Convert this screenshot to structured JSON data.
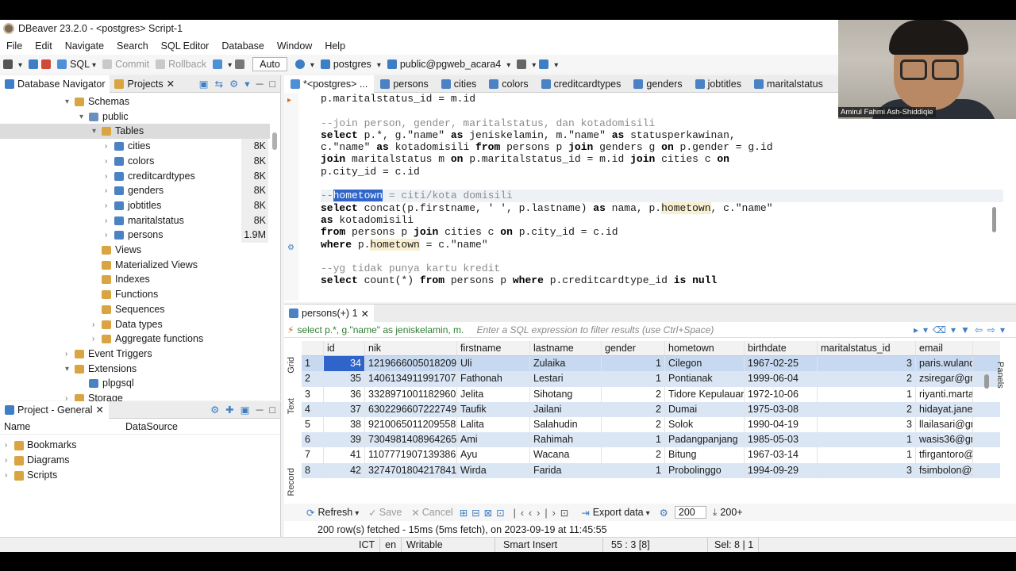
{
  "window": {
    "title": "DBeaver 23.2.0 - <postgres> Script-1"
  },
  "menu": [
    "File",
    "Edit",
    "Navigate",
    "Search",
    "SQL Editor",
    "Database",
    "Window",
    "Help"
  ],
  "toolbar": {
    "sql": "SQL",
    "commit": "Commit",
    "rollback": "Rollback",
    "auto": "Auto",
    "connection": "postgres",
    "schema": "public@pgweb_acara4"
  },
  "webcam": {
    "name": "Amirul Fahmi Ash-Shiddiqie"
  },
  "navigator": {
    "tabs": [
      "Database Navigator",
      "Projects"
    ],
    "tree": [
      {
        "label": "Schemas",
        "level": 0,
        "twist": "▾",
        "icon": "folder-icon",
        "color": "#d9a441"
      },
      {
        "label": "public",
        "level": 1,
        "twist": "▾",
        "icon": "schema-icon",
        "color": "#6b8fbf"
      },
      {
        "label": "Tables",
        "level": 2,
        "twist": "▾",
        "icon": "folder-icon",
        "color": "#d9a441",
        "selected": true
      },
      {
        "label": "cities",
        "level": 3,
        "twist": "›",
        "icon": "table-icon",
        "color": "#4a82c3",
        "size": "8K"
      },
      {
        "label": "colors",
        "level": 3,
        "twist": "›",
        "icon": "table-icon",
        "color": "#4a82c3",
        "size": "8K"
      },
      {
        "label": "creditcardtypes",
        "level": 3,
        "twist": "›",
        "icon": "table-icon",
        "color": "#4a82c3",
        "size": "8K"
      },
      {
        "label": "genders",
        "level": 3,
        "twist": "›",
        "icon": "table-icon",
        "color": "#4a82c3",
        "size": "8K"
      },
      {
        "label": "jobtitles",
        "level": 3,
        "twist": "›",
        "icon": "table-icon",
        "color": "#4a82c3",
        "size": "8K"
      },
      {
        "label": "maritalstatus",
        "level": 3,
        "twist": "›",
        "icon": "table-icon",
        "color": "#4a82c3",
        "size": "8K"
      },
      {
        "label": "persons",
        "level": 3,
        "twist": "›",
        "icon": "table-icon",
        "color": "#4a82c3",
        "size": "1.9M"
      },
      {
        "label": "Views",
        "level": 2,
        "twist": "",
        "icon": "folder-icon",
        "color": "#d9a441"
      },
      {
        "label": "Materialized Views",
        "level": 2,
        "twist": "",
        "icon": "folder-icon",
        "color": "#d9a441"
      },
      {
        "label": "Indexes",
        "level": 2,
        "twist": "",
        "icon": "folder-icon",
        "color": "#d9a441"
      },
      {
        "label": "Functions",
        "level": 2,
        "twist": "",
        "icon": "folder-icon",
        "color": "#d9a441"
      },
      {
        "label": "Sequences",
        "level": 2,
        "twist": "",
        "icon": "folder-icon",
        "color": "#d9a441"
      },
      {
        "label": "Data types",
        "level": 2,
        "twist": "›",
        "icon": "folder-icon",
        "color": "#d9a441"
      },
      {
        "label": "Aggregate functions",
        "level": 2,
        "twist": "›",
        "icon": "folder-icon",
        "color": "#d9a441"
      },
      {
        "label": "Event Triggers",
        "level": 0,
        "twist": "›",
        "icon": "folder-icon",
        "color": "#d9a441"
      },
      {
        "label": "Extensions",
        "level": 0,
        "twist": "▾",
        "icon": "folder-icon",
        "color": "#d9a441"
      },
      {
        "label": "plpgsql",
        "level": 1,
        "twist": "",
        "icon": "extension-icon",
        "color": "#4a82c3"
      },
      {
        "label": "Storage",
        "level": 0,
        "twist": "›",
        "icon": "folder-icon",
        "color": "#d9a441"
      }
    ]
  },
  "project": {
    "tab": "Project - General",
    "columns": [
      "Name",
      "DataSource"
    ],
    "items": [
      "Bookmarks",
      "Diagrams",
      "Scripts"
    ]
  },
  "editor": {
    "tabs": [
      "*<postgres> ...",
      "persons",
      "cities",
      "colors",
      "creditcardtypes",
      "genders",
      "jobtitles",
      "maritalstatus"
    ]
  },
  "results": {
    "tab": "persons(+) 1",
    "filter_query": "select p.*, g.\"name\" as jeniskelamin, m.",
    "filter_placeholder": "Enter a SQL expression to filter results (use Ctrl+Space)",
    "columns": [
      "id",
      "nik",
      "firstname",
      "lastname",
      "gender",
      "hometown",
      "birthdate",
      "maritalstatus_id",
      "email"
    ],
    "rows": [
      [
        "1",
        "34",
        "1219666005018209",
        "Uli",
        "Zulaika",
        "1",
        "Cilegon",
        "1967-02-25",
        "3",
        "paris.wulanda"
      ],
      [
        "2",
        "35",
        "1406134911991707",
        "Fathonah",
        "Lestari",
        "1",
        "Pontianak",
        "1999-06-04",
        "2",
        "zsiregar@gm"
      ],
      [
        "3",
        "36",
        "3328971001182960",
        "Jelita",
        "Sihotang",
        "2",
        "Tidore Kepulauan",
        "1972-10-06",
        "1",
        "riyanti.martar"
      ],
      [
        "4",
        "37",
        "6302296607222749",
        "Taufik",
        "Jailani",
        "2",
        "Dumai",
        "1975-03-08",
        "2",
        "hidayat.jane@"
      ],
      [
        "5",
        "38",
        "9210065011209558",
        "Lalita",
        "Salahudin",
        "2",
        "Solok",
        "1990-04-19",
        "3",
        "llailasari@gm"
      ],
      [
        "6",
        "39",
        "7304981408964265",
        "Ami",
        "Rahimah",
        "1",
        "Padangpanjang",
        "1985-05-03",
        "1",
        "wasis36@gm"
      ],
      [
        "7",
        "41",
        "1107771907139386",
        "Ayu",
        "Wacana",
        "2",
        "Bitung",
        "1967-03-14",
        "1",
        "tfirgantoro@"
      ],
      [
        "8",
        "42",
        "3274701804217841",
        "Wirda",
        "Farida",
        "1",
        "Probolinggo",
        "1994-09-29",
        "3",
        "fsimbolon@y"
      ]
    ],
    "side_tabs": [
      "Grid",
      "Text",
      "Record"
    ],
    "refresh": "Refresh",
    "save": "Save",
    "cancel": "Cancel",
    "export": "Export data",
    "limit": "200",
    "count": "200+",
    "panels": "Panels"
  },
  "status": {
    "message": "200 row(s) fetched - 15ms (5ms fetch), on 2023-09-19 at 11:45:55",
    "tz": "ICT",
    "lang": "en",
    "mode": "Writable",
    "insert": "Smart Insert",
    "pos": "55 : 3 [8]",
    "sel": "Sel: 8 | 1"
  }
}
